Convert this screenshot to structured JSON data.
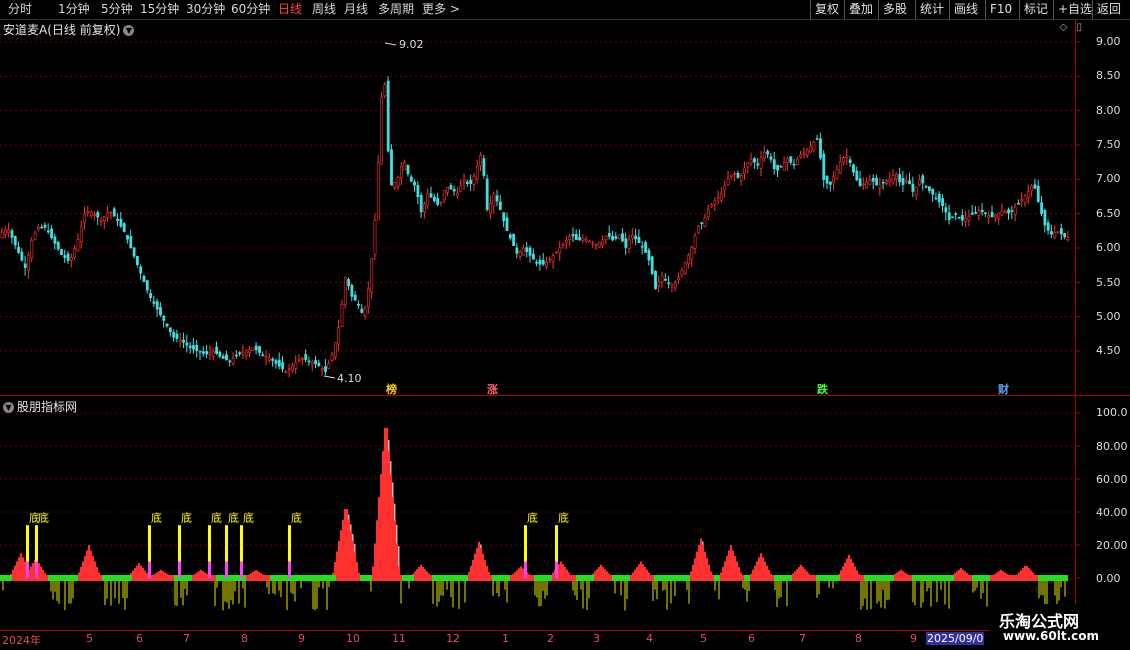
{
  "toolbar": {
    "periods": [
      "分时",
      "1分钟",
      "5分钟",
      "15分钟",
      "30分钟",
      "60分钟",
      "日线",
      "周线",
      "月线",
      "多周期",
      "更多 >"
    ],
    "active_period": "日线",
    "right_buttons": [
      "复权",
      "叠加",
      "多股",
      "统计",
      "画线",
      "F10",
      "标记",
      "+自选",
      "返回"
    ]
  },
  "stock": {
    "title": "安道麦A(日线 前复权)"
  },
  "indicator": {
    "title": "股朋指标网"
  },
  "price_axis": {
    "ticks": [
      "9.00",
      "8.50",
      "8.00",
      "7.50",
      "7.00",
      "6.50",
      "6.00",
      "5.50",
      "5.00",
      "4.50"
    ]
  },
  "ind_axis": {
    "ticks": [
      "100.0",
      "80.00",
      "60.00",
      "40.00",
      "20.00",
      "0.00"
    ]
  },
  "annotations": {
    "high": "9.02",
    "low": "4.10"
  },
  "events": [
    {
      "label": "榜",
      "color": "#ffcc00"
    },
    {
      "label": "涨",
      "color": "#ff6060"
    },
    {
      "label": "跌",
      "color": "#40ff40"
    },
    {
      "label": "财",
      "color": "#60a0ff"
    }
  ],
  "signal_label": "底",
  "dates": [
    "2024年",
    "5",
    "6",
    "7",
    "8",
    "9",
    "10",
    "11",
    "12",
    "1",
    "2",
    "3",
    "4",
    "5",
    "6",
    "7",
    "8",
    "9",
    "2025/09/0"
  ],
  "watermark": {
    "line1": "乐淘公式网",
    "line2": "www.60lt.com"
  },
  "colors": {
    "up": "#ff3030",
    "down": "#40e0e0",
    "grid": "#6a0000",
    "axis": "#aa0000"
  },
  "chart_data": {
    "type": "candlestick",
    "price_range": [
      4.0,
      9.2
    ],
    "price_path": [
      [
        0,
        6.2
      ],
      [
        8,
        6.3
      ],
      [
        14,
        6.1
      ],
      [
        20,
        5.9
      ],
      [
        26,
        5.7
      ],
      [
        32,
        6.1
      ],
      [
        38,
        6.3
      ],
      [
        46,
        6.3
      ],
      [
        54,
        6.1
      ],
      [
        62,
        5.9
      ],
      [
        70,
        5.8
      ],
      [
        78,
        6.1
      ],
      [
        86,
        6.55
      ],
      [
        94,
        6.5
      ],
      [
        102,
        6.4
      ],
      [
        110,
        6.55
      ],
      [
        118,
        6.4
      ],
      [
        126,
        6.2
      ],
      [
        134,
        5.9
      ],
      [
        142,
        5.6
      ],
      [
        150,
        5.3
      ],
      [
        158,
        5.1
      ],
      [
        166,
        4.9
      ],
      [
        174,
        4.7
      ],
      [
        182,
        4.65
      ],
      [
        190,
        4.55
      ],
      [
        198,
        4.5
      ],
      [
        206,
        4.45
      ],
      [
        214,
        4.5
      ],
      [
        222,
        4.4
      ],
      [
        230,
        4.35
      ],
      [
        238,
        4.45
      ],
      [
        246,
        4.5
      ],
      [
        254,
        4.55
      ],
      [
        262,
        4.45
      ],
      [
        270,
        4.4
      ],
      [
        278,
        4.3
      ],
      [
        286,
        4.2
      ],
      [
        294,
        4.3
      ],
      [
        302,
        4.4
      ],
      [
        310,
        4.35
      ],
      [
        318,
        4.3
      ],
      [
        326,
        4.2
      ],
      [
        334,
        4.5
      ],
      [
        340,
        4.9
      ],
      [
        346,
        5.6
      ],
      [
        352,
        5.3
      ],
      [
        358,
        5.2
      ],
      [
        364,
        5.0
      ],
      [
        370,
        5.5
      ],
      [
        376,
        6.5
      ],
      [
        380,
        7.6
      ],
      [
        384,
        8.8
      ],
      [
        388,
        7.5
      ],
      [
        392,
        6.9
      ],
      [
        398,
        7.0
      ],
      [
        404,
        7.3
      ],
      [
        410,
        7.0
      ],
      [
        416,
        6.9
      ],
      [
        422,
        6.5
      ],
      [
        428,
        6.8
      ],
      [
        434,
        6.7
      ],
      [
        440,
        6.6
      ],
      [
        446,
        6.9
      ],
      [
        452,
        6.85
      ],
      [
        458,
        6.8
      ],
      [
        464,
        7.0
      ],
      [
        470,
        6.9
      ],
      [
        476,
        7.1
      ],
      [
        482,
        7.4
      ],
      [
        488,
        6.5
      ],
      [
        494,
        6.8
      ],
      [
        500,
        6.6
      ],
      [
        506,
        6.3
      ],
      [
        512,
        6.1
      ],
      [
        518,
        5.9
      ],
      [
        524,
        6.0
      ],
      [
        530,
        5.9
      ],
      [
        536,
        5.8
      ],
      [
        542,
        5.75
      ],
      [
        548,
        5.8
      ],
      [
        554,
        5.9
      ],
      [
        560,
        6.0
      ],
      [
        566,
        6.1
      ],
      [
        572,
        6.2
      ],
      [
        578,
        6.1
      ],
      [
        584,
        6.15
      ],
      [
        590,
        6.1
      ],
      [
        596,
        6.05
      ],
      [
        602,
        6.1
      ],
      [
        608,
        6.2
      ],
      [
        614,
        6.1
      ],
      [
        620,
        6.2
      ],
      [
        626,
        6.0
      ],
      [
        632,
        6.2
      ],
      [
        638,
        6.1
      ],
      [
        644,
        6.0
      ],
      [
        650,
        5.8
      ],
      [
        656,
        5.4
      ],
      [
        662,
        5.6
      ],
      [
        668,
        5.5
      ],
      [
        674,
        5.45
      ],
      [
        680,
        5.6
      ],
      [
        686,
        5.8
      ],
      [
        692,
        6.0
      ],
      [
        698,
        6.3
      ],
      [
        704,
        6.4
      ],
      [
        710,
        6.6
      ],
      [
        716,
        6.7
      ],
      [
        722,
        6.8
      ],
      [
        728,
        7.0
      ],
      [
        734,
        7.1
      ],
      [
        740,
        7.0
      ],
      [
        746,
        7.2
      ],
      [
        752,
        7.3
      ],
      [
        758,
        7.2
      ],
      [
        764,
        7.4
      ],
      [
        770,
        7.35
      ],
      [
        776,
        7.1
      ],
      [
        782,
        7.2
      ],
      [
        788,
        7.3
      ],
      [
        794,
        7.2
      ],
      [
        800,
        7.35
      ],
      [
        806,
        7.4
      ],
      [
        812,
        7.5
      ],
      [
        818,
        7.6
      ],
      [
        824,
        7.0
      ],
      [
        830,
        6.9
      ],
      [
        836,
        7.1
      ],
      [
        842,
        7.3
      ],
      [
        848,
        7.35
      ],
      [
        854,
        7.1
      ],
      [
        860,
        6.9
      ],
      [
        866,
        6.95
      ],
      [
        872,
        7.0
      ],
      [
        878,
        6.9
      ],
      [
        884,
        6.95
      ],
      [
        890,
        7.0
      ],
      [
        896,
        7.1
      ],
      [
        902,
        6.9
      ],
      [
        908,
        7.0
      ],
      [
        914,
        6.8
      ],
      [
        920,
        7.0
      ],
      [
        926,
        6.9
      ],
      [
        932,
        6.8
      ],
      [
        938,
        6.7
      ],
      [
        944,
        6.6
      ],
      [
        950,
        6.4
      ],
      [
        956,
        6.5
      ],
      [
        962,
        6.4
      ],
      [
        968,
        6.45
      ],
      [
        974,
        6.5
      ],
      [
        980,
        6.55
      ],
      [
        986,
        6.5
      ],
      [
        992,
        6.45
      ],
      [
        998,
        6.5
      ],
      [
        1004,
        6.55
      ],
      [
        1010,
        6.5
      ],
      [
        1016,
        6.6
      ],
      [
        1022,
        6.7
      ],
      [
        1028,
        6.8
      ],
      [
        1034,
        6.95
      ],
      [
        1040,
        6.6
      ],
      [
        1046,
        6.3
      ],
      [
        1052,
        6.2
      ],
      [
        1058,
        6.25
      ],
      [
        1066,
        6.15
      ]
    ],
    "indicator_range": [
      -20,
      105
    ],
    "indicator_peaks": [
      [
        20,
        15
      ],
      [
        35,
        12
      ],
      [
        88,
        20
      ],
      [
        138,
        9
      ],
      [
        160,
        5
      ],
      [
        200,
        5
      ],
      [
        255,
        5
      ],
      [
        345,
        45
      ],
      [
        385,
        98
      ],
      [
        420,
        8
      ],
      [
        478,
        22
      ],
      [
        520,
        7
      ],
      [
        560,
        10
      ],
      [
        600,
        8
      ],
      [
        640,
        10
      ],
      [
        700,
        24
      ],
      [
        730,
        20
      ],
      [
        760,
        15
      ],
      [
        800,
        8
      ],
      [
        848,
        14
      ],
      [
        900,
        5
      ],
      [
        960,
        6
      ],
      [
        1000,
        5
      ],
      [
        1025,
        8
      ]
    ],
    "bottom_signals": [
      28,
      37,
      150,
      180,
      210,
      227,
      242,
      290,
      526,
      557
    ]
  }
}
